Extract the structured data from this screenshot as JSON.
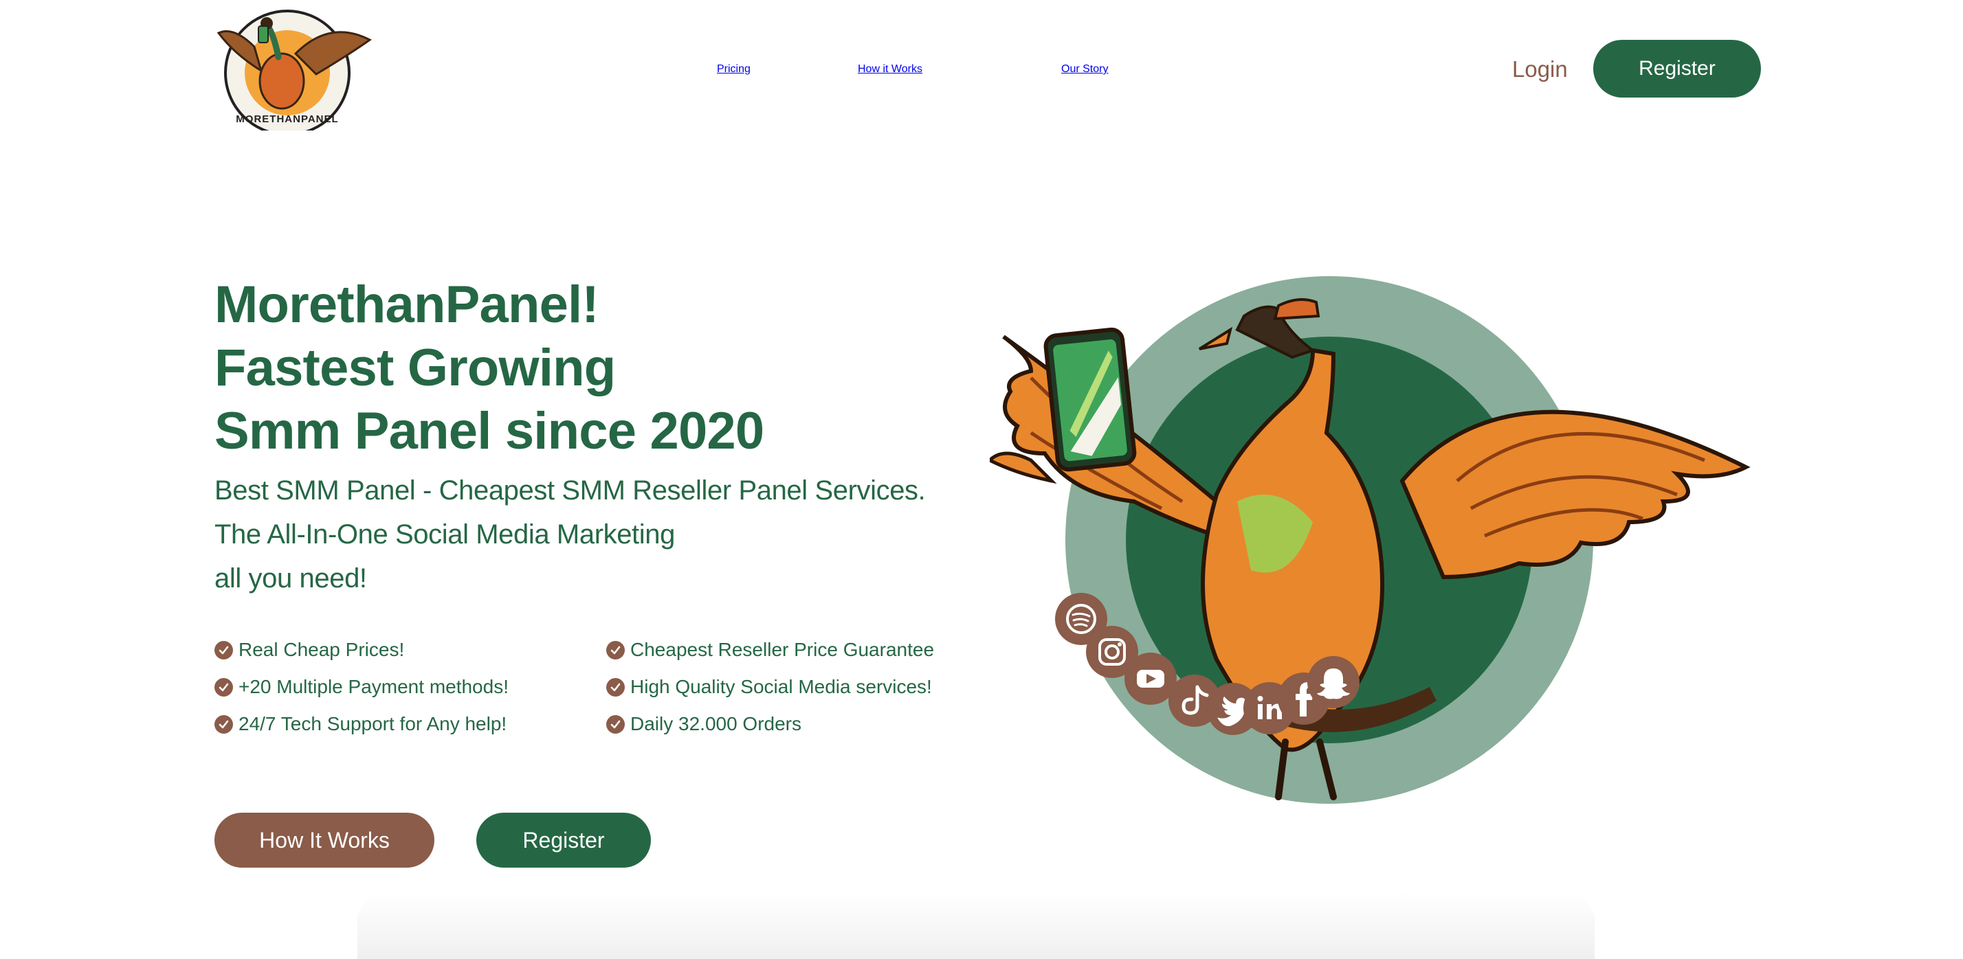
{
  "brand": {
    "logo_text": "MORETHANPANEL",
    "accent_green": "#256745",
    "accent_brown": "#8a5c49"
  },
  "nav": {
    "items": [
      {
        "label": "Pricing"
      },
      {
        "label": "How it Works"
      },
      {
        "label": "Our Story"
      }
    ],
    "login": "Login",
    "register": "Register"
  },
  "hero": {
    "title_lines": [
      "MorethanPanel!",
      "Fastest Growing",
      "Smm Panel since 2020"
    ],
    "subtitle_lines": [
      "Best SMM Panel - Cheapest SMM Reseller Panel Services.",
      "The All-In-One Social Media Marketing",
      "all you need!"
    ],
    "features": [
      "Real Cheap Prices!",
      "Cheapest Reseller Price Guarantee",
      "+20 Multiple Payment methods!",
      "High Quality Social Media services!",
      "24/7 Tech Support for Any help!",
      "Daily 32.000 Orders"
    ],
    "how_button": "How It Works",
    "register_button": "Register",
    "social_icons": [
      "spotify-icon",
      "instagram-icon",
      "youtube-icon",
      "tiktok-icon",
      "twitter-icon",
      "linkedin-icon",
      "facebook-icon",
      "snapchat-icon"
    ]
  }
}
